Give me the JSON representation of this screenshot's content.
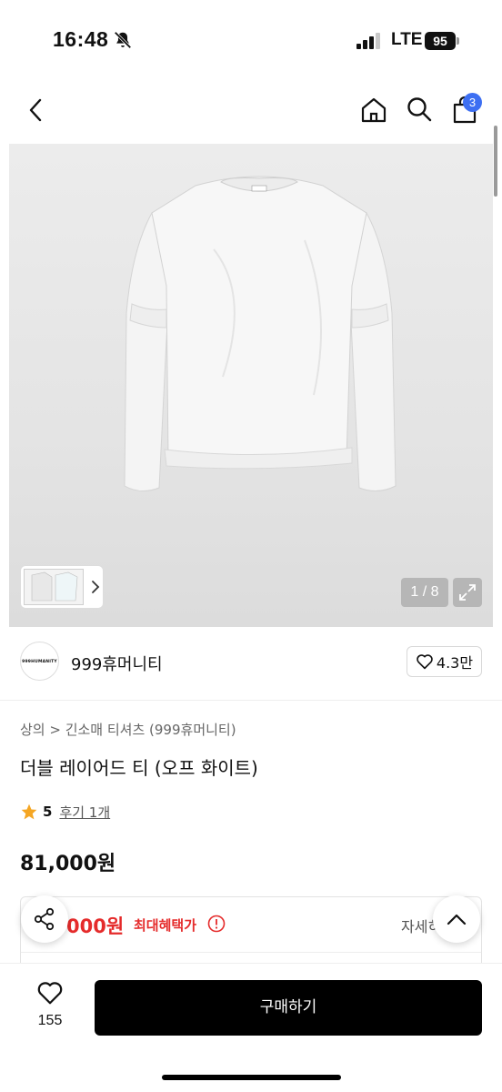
{
  "status": {
    "time": "16:48",
    "network": "LTE",
    "battery": "95"
  },
  "nav": {
    "cart_count": "3"
  },
  "gallery": {
    "counter": "1 / 8"
  },
  "brand": {
    "logo_text": "999HUMANITY",
    "name": "999휴머니티",
    "likes": "4.3만"
  },
  "product": {
    "breadcrumb": "상의 > 긴소매 티셔츠 (999휴머니티)",
    "title": "더블 레이어드 티 (오프 화이트)",
    "rating": "5",
    "reviews": "후기 1개",
    "price": "81,000원"
  },
  "benefit": {
    "price": "000원",
    "label": "최대혜택가",
    "detail": "자세히"
  },
  "bottom": {
    "wish_count": "155",
    "buy_label": "구매하기"
  },
  "colors": {
    "accent_blue": "#3d6ff2",
    "benefit_red": "#e52b2b",
    "star": "#f5a623",
    "button": "#000000"
  }
}
